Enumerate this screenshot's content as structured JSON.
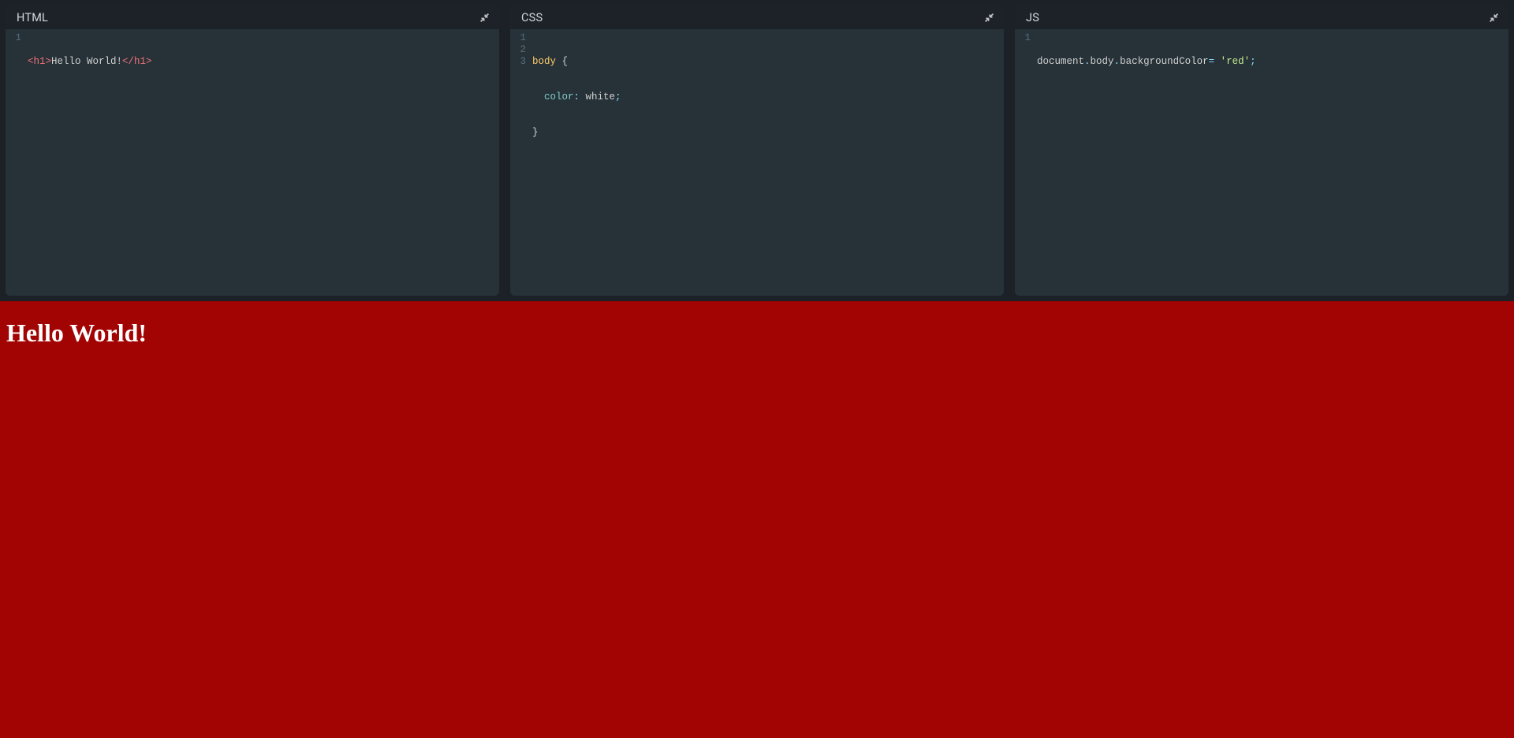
{
  "panels": {
    "html": {
      "title": "HTML",
      "line_numbers": [
        "1"
      ],
      "code": {
        "l1": {
          "tag_open": "<h1>",
          "text": "Hello World!",
          "tag_close": "</h1>"
        }
      }
    },
    "css": {
      "title": "CSS",
      "line_numbers": [
        "1",
        "2",
        "3"
      ],
      "code": {
        "l1_selector": "body",
        "l1_brace": " {",
        "l2_prop": "  color",
        "l2_colon": ": ",
        "l2_value": "white",
        "l2_semi": ";",
        "l3_brace": "}"
      }
    },
    "js": {
      "title": "JS",
      "line_numbers": [
        "1"
      ],
      "code": {
        "l1_a": "document",
        "l1_d1": ".",
        "l1_b": "body",
        "l1_d2": ".",
        "l1_c": "backgroundColor",
        "l1_eq": "= ",
        "l1_str": "'red'",
        "l1_semi": ";"
      }
    }
  },
  "preview": {
    "heading": "Hello World!",
    "background_color": "#a20303",
    "text_color": "#ffffff"
  }
}
